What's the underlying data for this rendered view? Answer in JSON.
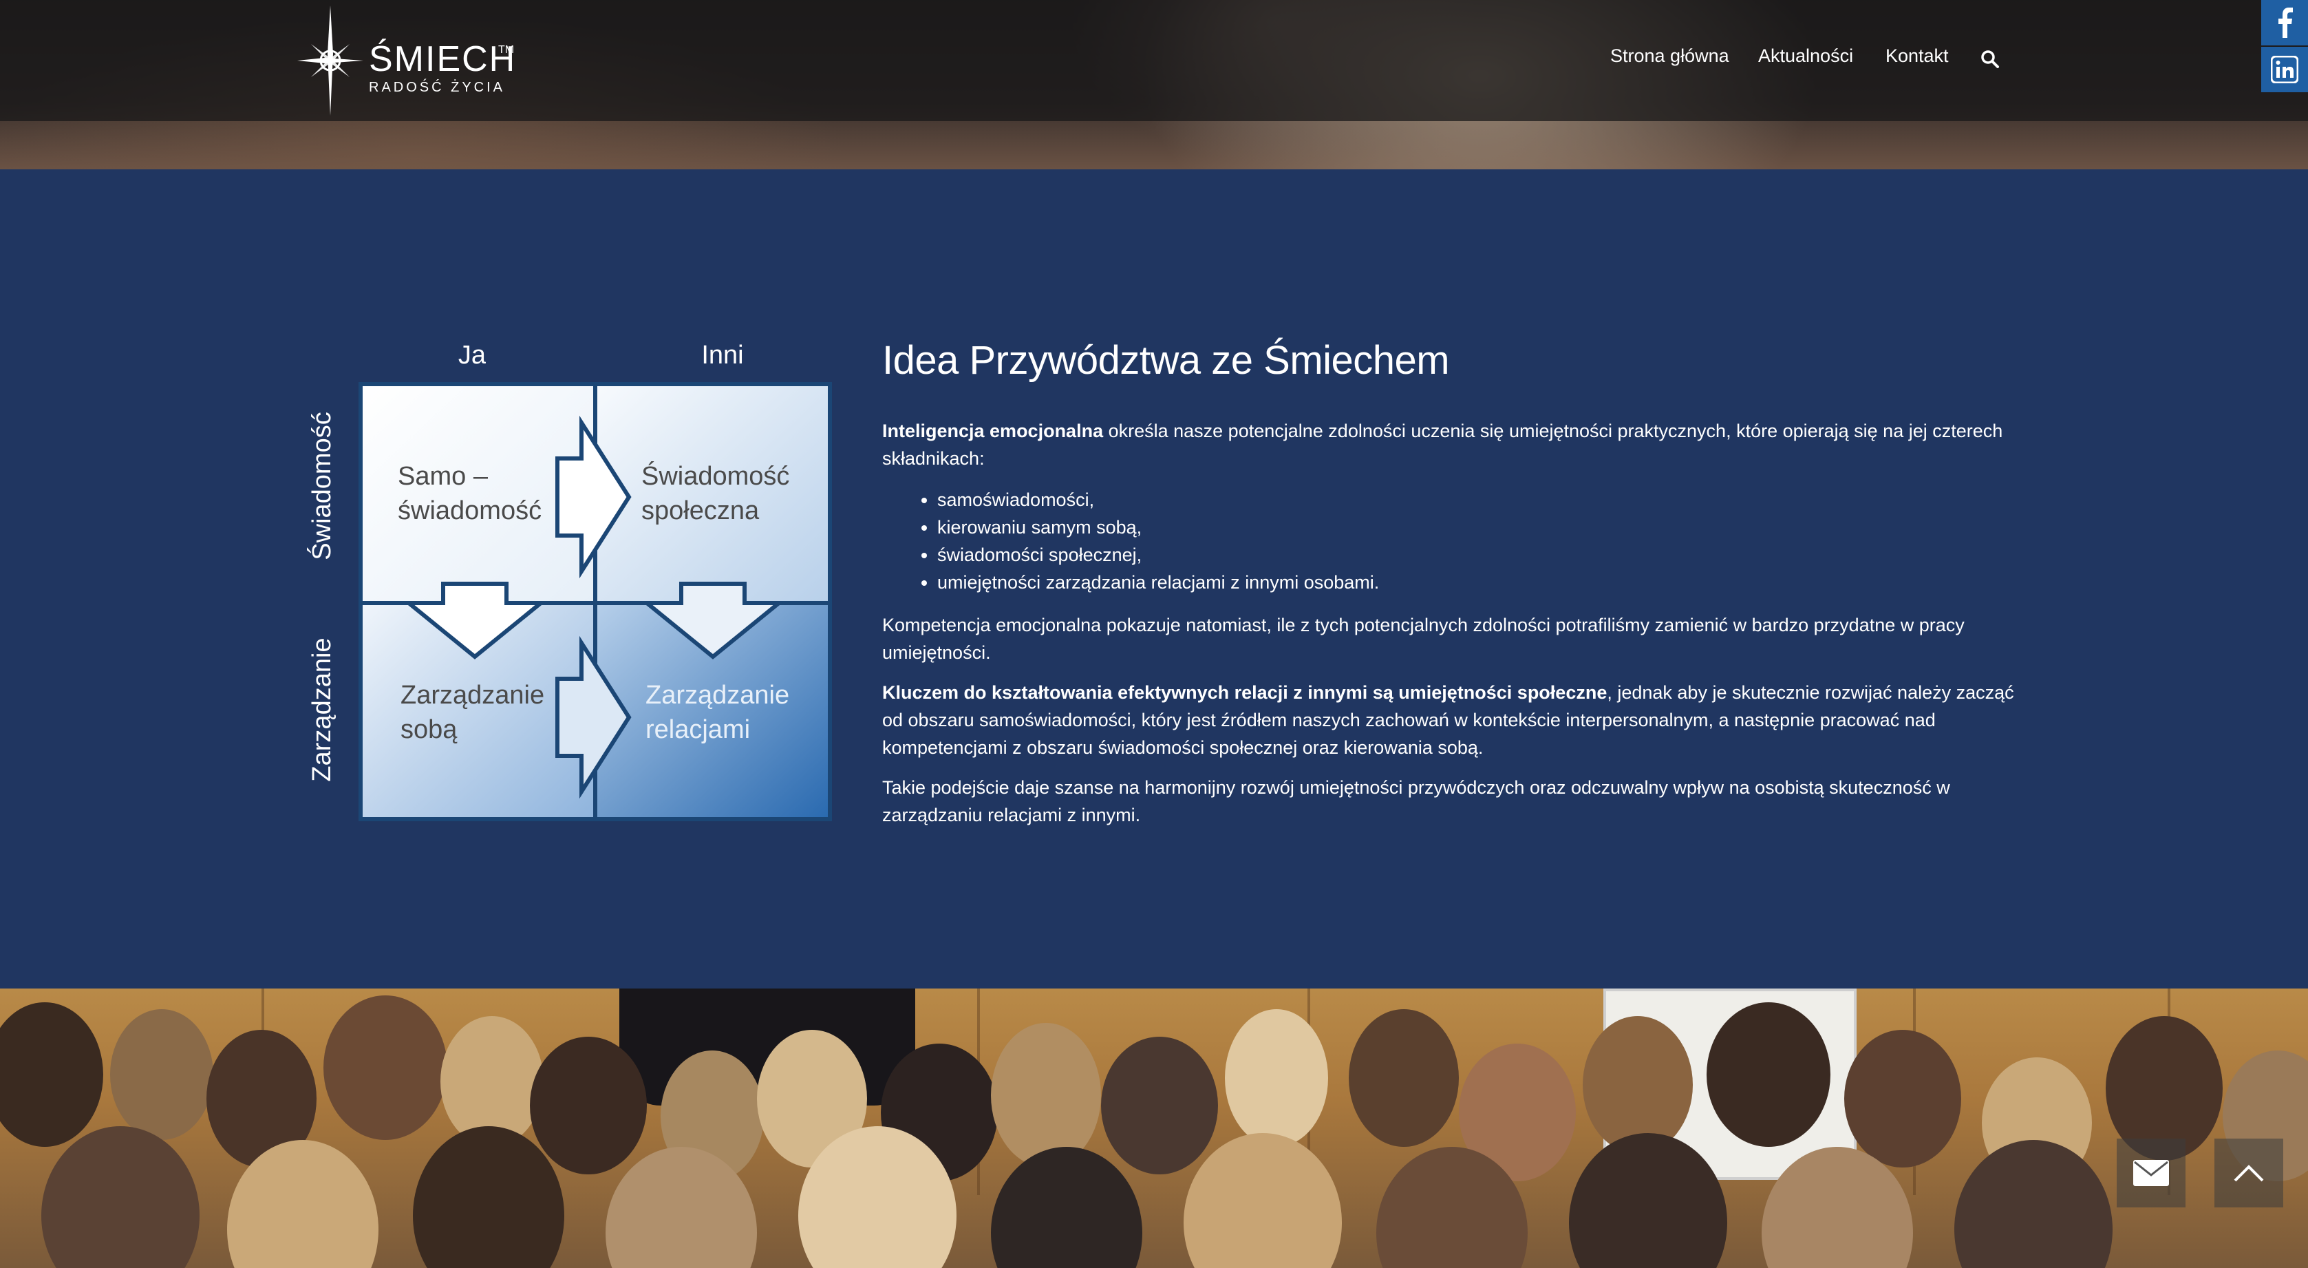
{
  "brand": {
    "name": "ŚMIECH",
    "trademark": "TM",
    "tagline": "RADOŚĆ ŻYCIA"
  },
  "nav": {
    "items": [
      "Strona główna",
      "Aktualności",
      "Kontakt"
    ],
    "search_icon": "search-icon"
  },
  "social": [
    "facebook-icon",
    "linkedin-icon"
  ],
  "diagram": {
    "col_labels": [
      "Ja",
      "Inni"
    ],
    "row_labels": [
      "Świadomość",
      "Zarządzanie"
    ],
    "cells": {
      "top_left": [
        "Samo –",
        "świadomość"
      ],
      "top_right": [
        "Świadomość",
        "społeczna"
      ],
      "bottom_left": [
        "Zarządzanie",
        "sobą"
      ],
      "bottom_right": [
        "Zarządzanie",
        "relacjami"
      ]
    }
  },
  "article": {
    "title": "Idea Przywództwa ze Śmiechem",
    "p1_bold": "Inteligencja emocjonalna",
    "p1_rest": " określa nasze potencjalne zdolności uczenia się umiejętności praktycznych, które opierają się na jej czterech składnikach:",
    "list": [
      "samoświadomości,",
      "kierowaniu samym sobą,",
      "świadomości społecznej,",
      "umiejętności zarządzania relacjami z innymi osobami."
    ],
    "p2": "Kompetencja emocjonalna pokazuje natomiast, ile z tych potencjalnych zdolności potrafiliśmy zamienić w bardzo przydatne w pracy umiejętności.",
    "p3_bold": "Kluczem do kształtowania efektywnych relacji z innymi są umiejętności społeczne",
    "p3_rest": ", jednak aby je skutecznie rozwijać należy zacząć od obszaru samoświadomości, który jest źródłem naszych zachowań w kontekście interpersonalnym, a następnie pracować nad kompetencjami z obszaru świadomości społecznej oraz kierowania sobą.",
    "p4": "Takie podejście daje szanse na harmonijny rozwój umiejętności przywódczych oraz odczuwalny wpływ na osobistą skuteczność w zarządzaniu relacjami z innymi."
  },
  "floating": [
    "envelope-icon",
    "chevron-up-icon"
  ],
  "colors": {
    "section_bg": "#203661",
    "social_bg": "#1f5fa3",
    "diagram_border": "#1b4675"
  }
}
